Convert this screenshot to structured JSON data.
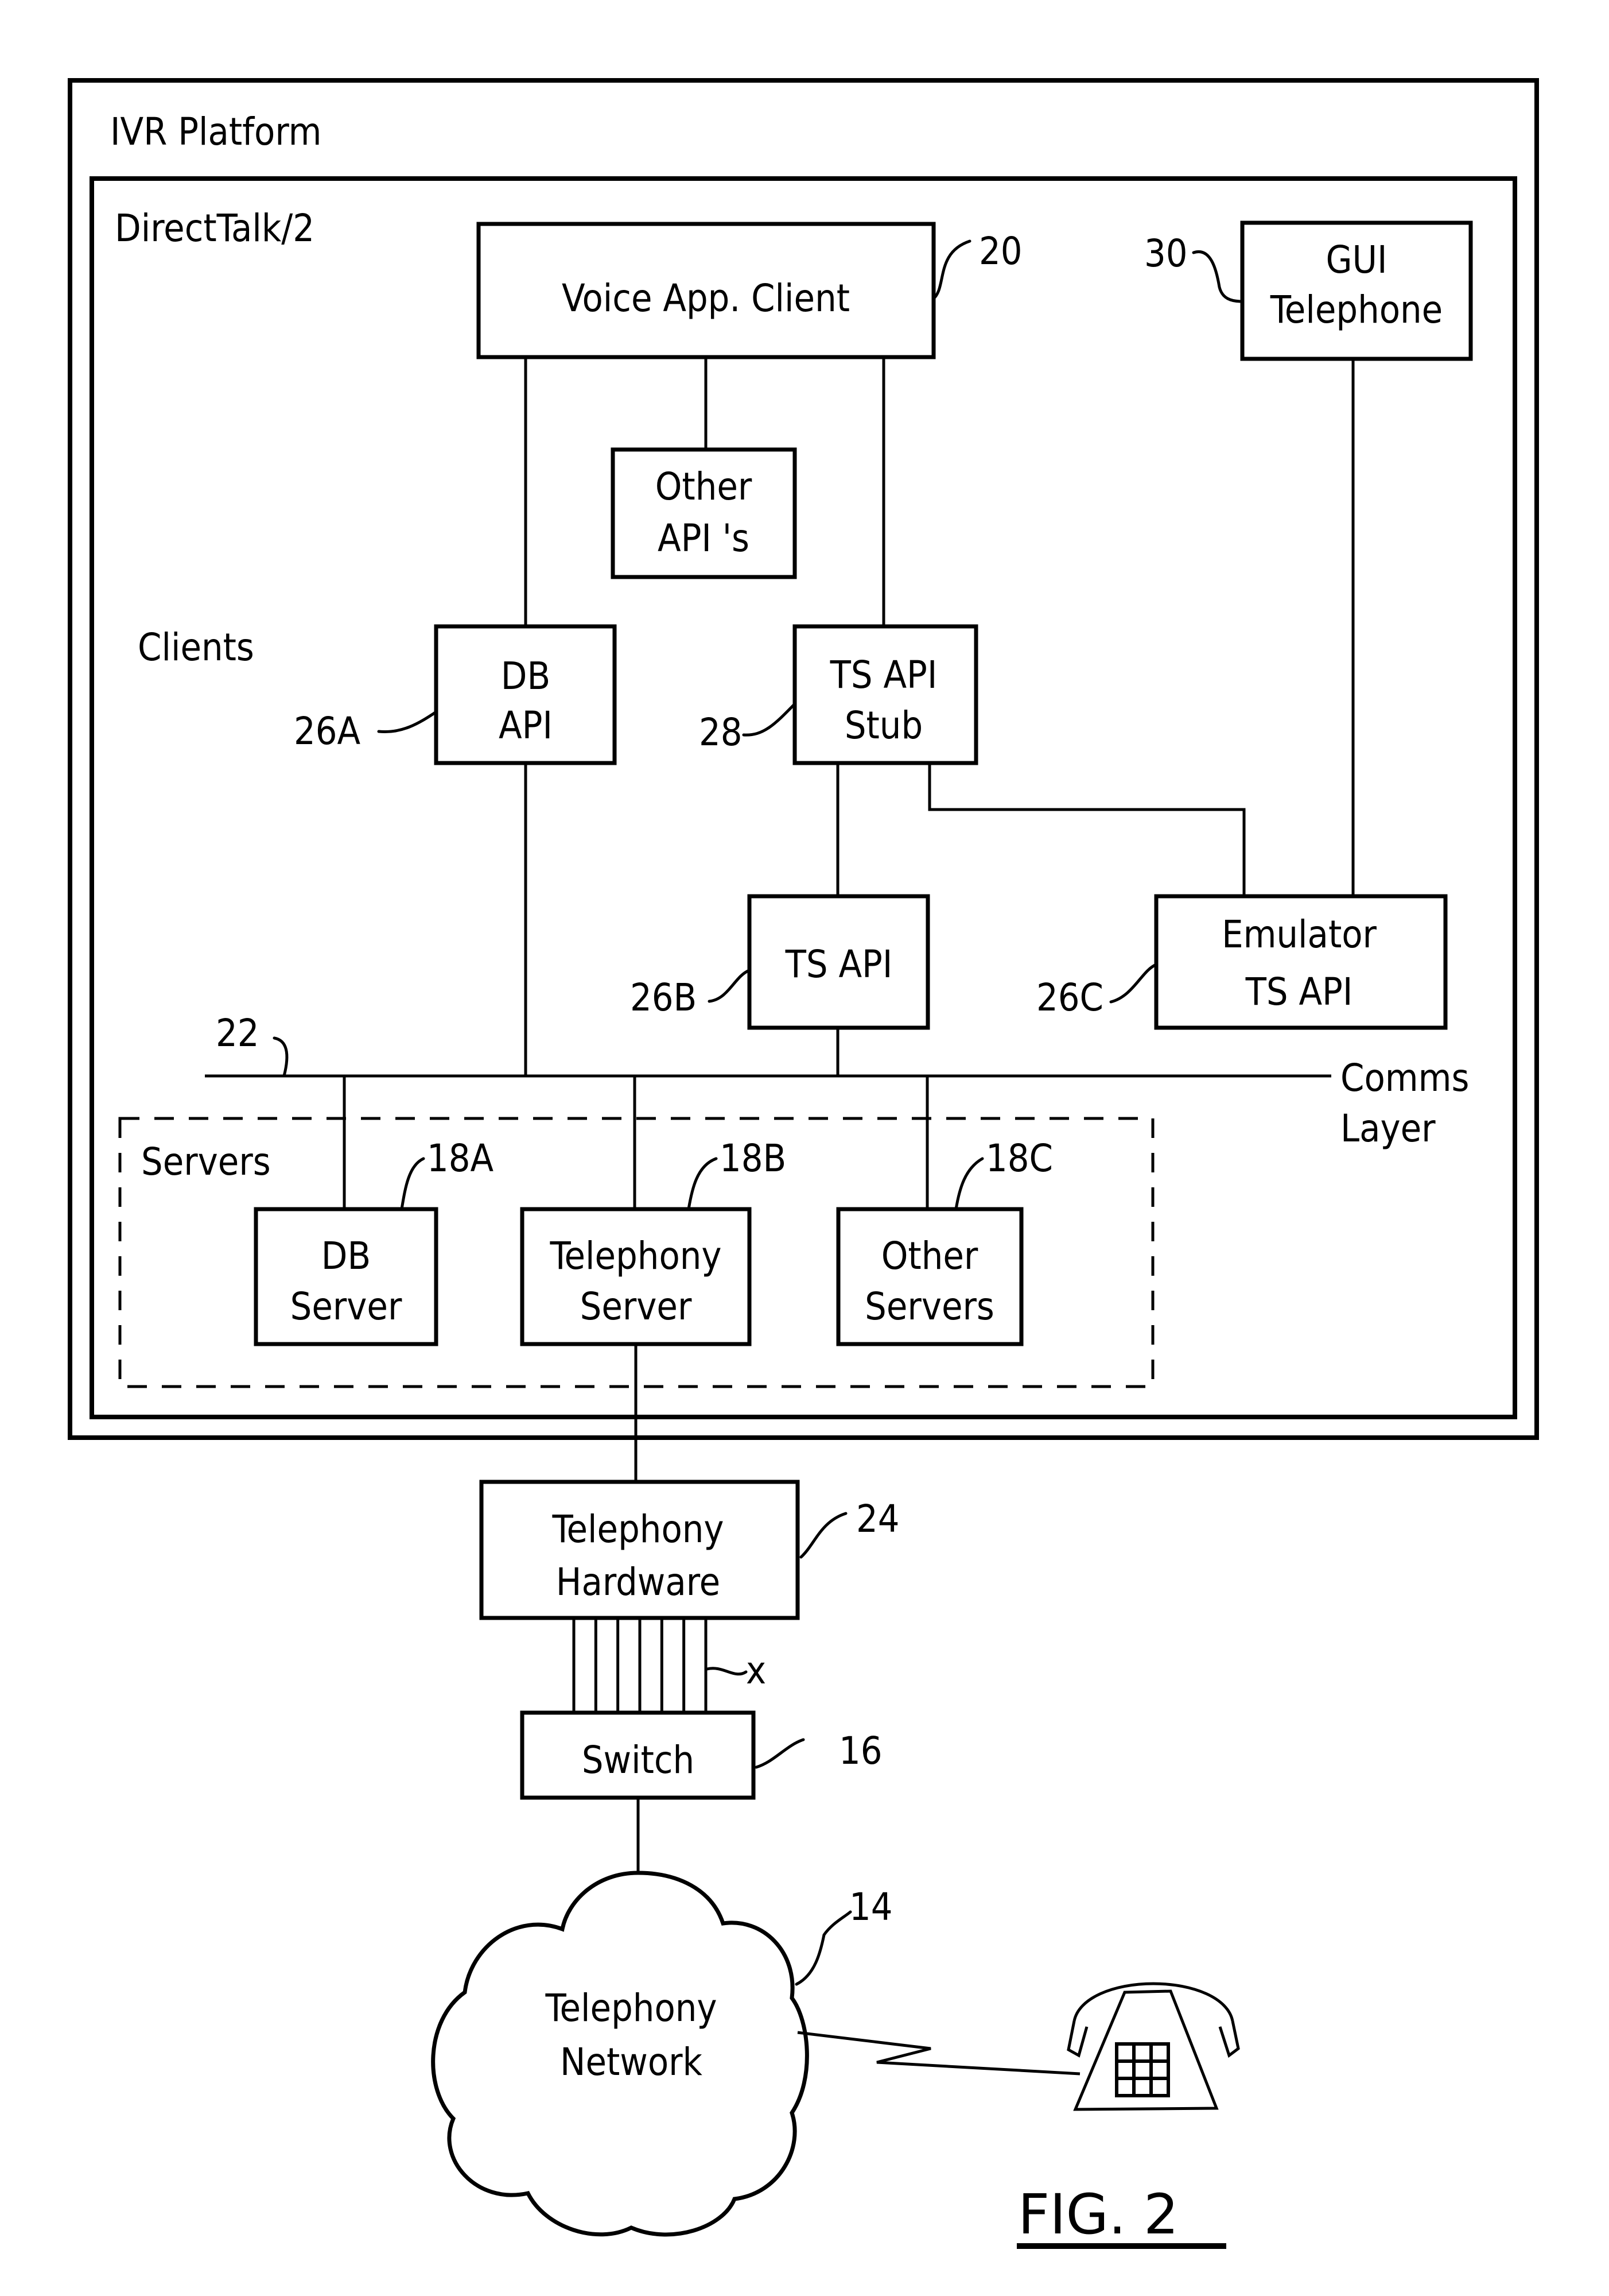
{
  "figure": {
    "caption": "FIG. 2",
    "containers": {
      "ivr_platform": "IVR Platform",
      "directtalk": "DirectTalk/2",
      "clients": "Clients",
      "servers": "Servers",
      "comms_layer_line1": "Comms",
      "comms_layer_line2": "Layer"
    },
    "blocks": {
      "voice_app_client": {
        "line1": "Voice  App. Client",
        "ref": "20"
      },
      "gui_telephone": {
        "line1": "GUI",
        "line2": "Telephone",
        "ref": "30"
      },
      "other_apis": {
        "line1": "Other",
        "line2": "API 's"
      },
      "db_api": {
        "line1": "DB",
        "line2": "API",
        "ref": "26A"
      },
      "ts_api_stub": {
        "line1": "TS API",
        "line2": "Stub",
        "ref": "28"
      },
      "ts_api": {
        "line1": "TS API",
        "ref": "26B"
      },
      "emulator_ts_api": {
        "line1": "Emulator",
        "line2": "TS  API",
        "ref": "26C"
      },
      "db_server": {
        "line1": "DB",
        "line2": "Server",
        "ref": "18A"
      },
      "telephony_server": {
        "line1": "Telephony",
        "line2": "Server",
        "ref": "18B"
      },
      "other_servers": {
        "line1": "Other",
        "line2": "Servers",
        "ref": "18C"
      },
      "telephony_hardware": {
        "line1": "Telephony",
        "line2": "Hardware",
        "ref": "24"
      },
      "switch": {
        "line1": "Switch",
        "ref": "16"
      },
      "telephony_network": {
        "line1": "Telephony",
        "line2": "Network",
        "ref": "14"
      }
    },
    "comms_ref": "22",
    "trunk_lines_ref": "x",
    "trunk_line_count": 7
  }
}
